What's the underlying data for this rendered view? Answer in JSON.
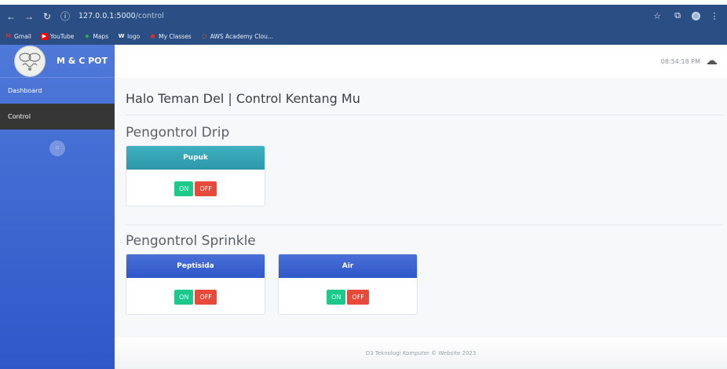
{
  "browser": {
    "url_host": "127.0.0.1:5000",
    "url_path": "/control",
    "bookmarks": [
      {
        "label": "Gmail",
        "icon": "gmail-icon",
        "color": "#ea4335"
      },
      {
        "label": "YouTube",
        "icon": "youtube-icon",
        "color": "#ff0000"
      },
      {
        "label": "Maps",
        "icon": "maps-icon",
        "color": "#34a853"
      },
      {
        "label": "logo",
        "icon": "w-logo-icon",
        "color": "#ffffff"
      },
      {
        "label": "My Classes",
        "icon": "classes-icon",
        "color": "#d93025"
      },
      {
        "label": "AWS Academy Clou...",
        "icon": "aws-icon",
        "color": "#e8710a"
      }
    ]
  },
  "sidebar": {
    "brand": "M & C POT",
    "items": [
      {
        "label": "Dashboard",
        "active": false
      },
      {
        "label": "Control",
        "active": true
      }
    ]
  },
  "topbar": {
    "time": "08:54:18 PM"
  },
  "main": {
    "page_title": "Halo Teman Del | Control Kentang Mu",
    "drip": {
      "title": "Pengontrol Drip",
      "cards": [
        {
          "label": "Pupuk",
          "on": "ON",
          "off": "OFF"
        }
      ]
    },
    "sprinkle": {
      "title": "Pengontrol Sprinkle",
      "cards": [
        {
          "label": "Peptisida",
          "on": "ON",
          "off": "OFF"
        },
        {
          "label": "Air",
          "on": "ON",
          "off": "OFF"
        }
      ]
    }
  },
  "footer": {
    "text": "D3 Teknologi Komputer © Website 2023"
  },
  "colors": {
    "sidebar": "#3a62cf",
    "teal_header": "#36a5b5",
    "blue_header": "#3b60cf",
    "on": "#1cc88a",
    "off": "#e74a3b"
  }
}
